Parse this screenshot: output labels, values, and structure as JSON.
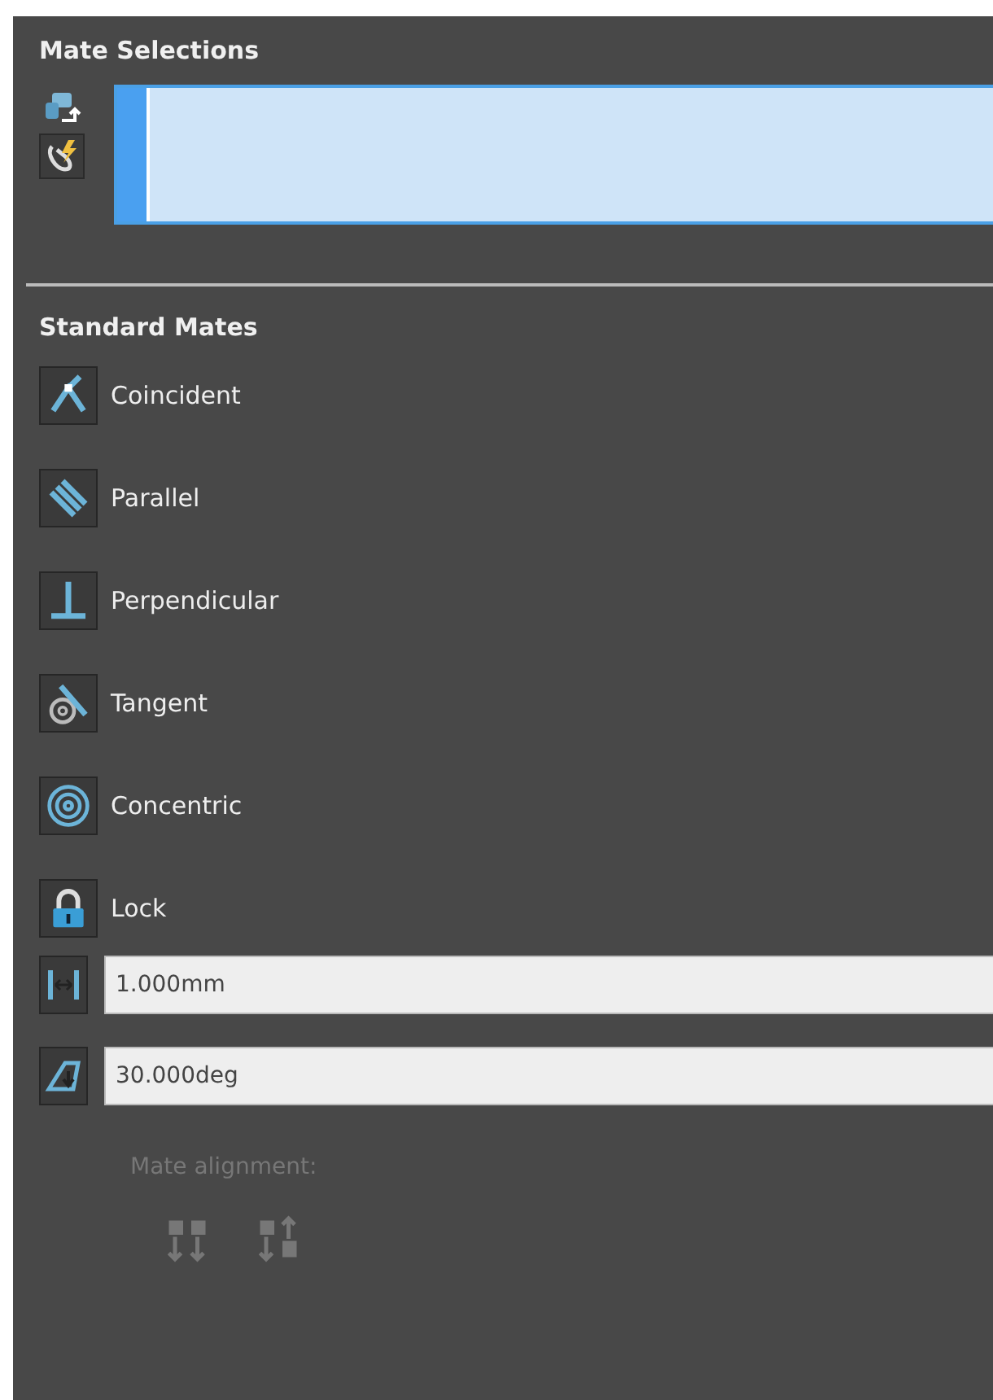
{
  "mate_selections": {
    "title": "Mate Selections",
    "focused": true
  },
  "standard_mates": {
    "title": "Standard Mates",
    "mates": [
      {
        "kind": "coincident",
        "label": "Coincident"
      },
      {
        "kind": "parallel",
        "label": "Parallel"
      },
      {
        "kind": "perpendicular",
        "label": "Perpendicular"
      },
      {
        "kind": "tangent",
        "label": "Tangent"
      },
      {
        "kind": "concentric",
        "label": "Concentric"
      },
      {
        "kind": "lock",
        "label": "Lock"
      }
    ],
    "fields": [
      {
        "kind": "distance",
        "value": "1.000mm"
      },
      {
        "kind": "angle",
        "value": "30.000deg"
      }
    ]
  },
  "mate_alignment": {
    "label": "Mate alignment:",
    "disabled": true,
    "options": [
      {
        "kind": "aligned"
      },
      {
        "kind": "anti-aligned"
      }
    ]
  }
}
